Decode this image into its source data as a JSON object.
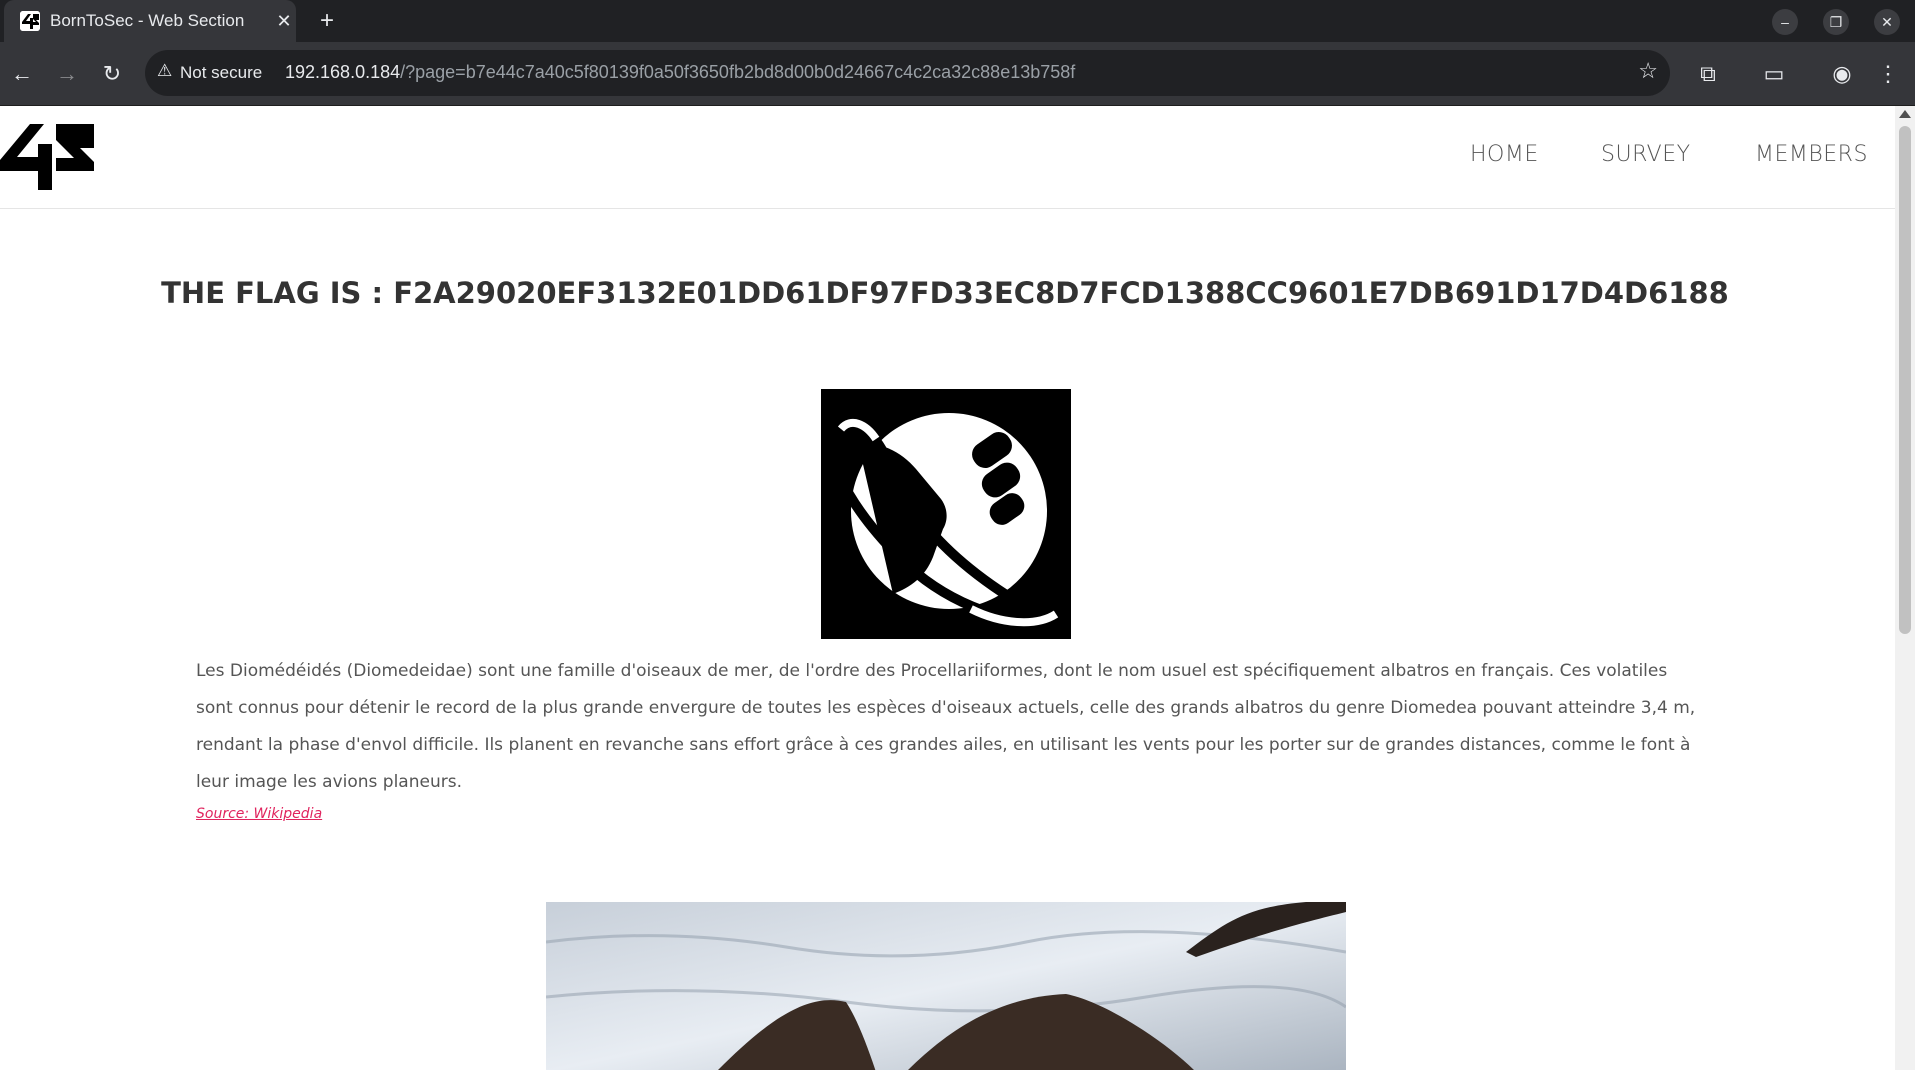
{
  "browser": {
    "tab_title": "BornToSec - Web Section",
    "tab_close": "✕",
    "new_tab": "+",
    "security_label": "Not secure",
    "url_host": "192.168.0.184",
    "url_path": "/?page=b7e44c7a40c5f80139f0a50f3650fb2bd8d00b0d24667c4c2ca32c88e13b758f"
  },
  "site": {
    "nav": [
      "HOME",
      "SURVEY",
      "MEMBERS"
    ],
    "flag_title": "THE FLAG IS : F2A29020EF3132E01DD61DF97FD33EC8D7FCD1388CC9601E7DB691D17D4D6188",
    "description": "Les Diomédéidés (Diomedeidae) sont une famille d'oiseaux de mer, de l'ordre des Procellariiformes, dont le nom usuel est spécifiquement albatros en français. Ces volatiles sont connus pour détenir le record de la plus grande envergure de toutes les espèces d'oiseaux actuels, celle des grands albatros du genre Diomedea pouvant atteindre 3,4 m, rendant la phase d'envol difficile. Ils planent en revanche sans effort grâce à ces grandes ailes, en utilisant les vents pour les porter sur de grandes distances, comme le font à leur image les avions planeurs.",
    "source_link": "Source: Wikipedia"
  },
  "icons": {
    "logo": "42-logo",
    "hero": "thumbs-up-planet-icon",
    "photo": "albatross-photo"
  },
  "colors": {
    "chrome_dark": "#202124",
    "chrome_mid": "#35363a",
    "link_accent": "#e0245e",
    "text": "#555555"
  }
}
